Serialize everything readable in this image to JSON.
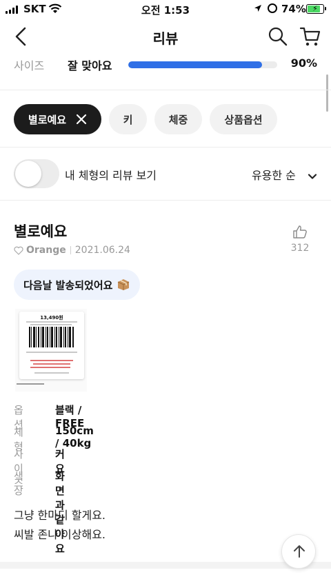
{
  "status_bar": {
    "carrier": "SKT",
    "time": "오전 1:53",
    "battery": "74%"
  },
  "nav": {
    "title": "리뷰",
    "icons": [
      "back-icon",
      "search-icon",
      "cart-icon"
    ]
  },
  "size_summary": {
    "label": "사이즈",
    "value": "잘 맞아요",
    "percent_text": "90%",
    "percent": 90,
    "bar_color": "#2f6fe6"
  },
  "filters": {
    "chips": [
      {
        "label": "별로예요",
        "active": true
      },
      {
        "label": "키",
        "active": false
      },
      {
        "label": "체중",
        "active": false
      },
      {
        "label": "상품옵션",
        "active": false
      }
    ]
  },
  "toggle": {
    "label": "내 체형의 리뷰 보기",
    "on": false
  },
  "sort": {
    "label": "유용한 순"
  },
  "review": {
    "title": "별로예요",
    "user": "Orange",
    "date": "2021.06.24",
    "likes": "312",
    "shipping_note": "다음날 발송되었어요",
    "photo": {
      "price": "13,490원"
    },
    "details": [
      {
        "key": "옵션",
        "value": "블랙 / FREE"
      },
      {
        "key": "체형",
        "value": "150cm / 40kg"
      },
      {
        "key": "사이즈",
        "value": "커요"
      },
      {
        "key": "색상",
        "value": "화면과 같아요"
      }
    ],
    "body_lines": [
      "그냥 한마디 할게요.",
      "씨발 존나 이상해요."
    ]
  },
  "colors": {
    "chip_active_bg": "#1c1c1c",
    "chip_bg": "#f2f2f2",
    "bubble_bg": "#eef3fd",
    "muted_text": "#9a9a9a"
  }
}
